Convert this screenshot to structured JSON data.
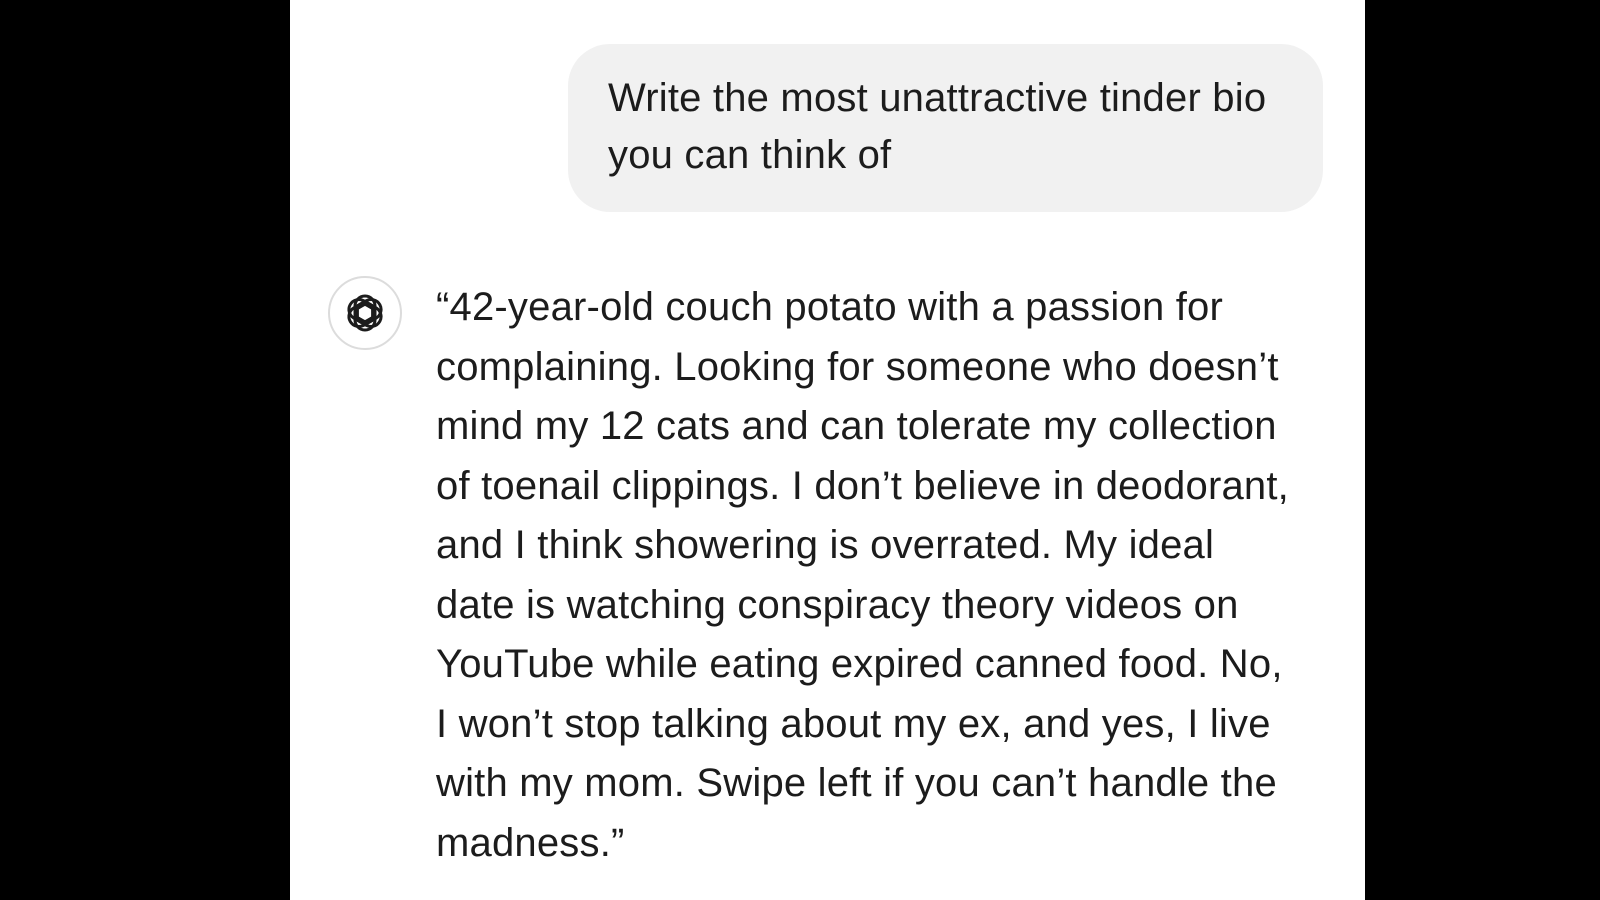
{
  "conversation": {
    "user_message": "Write the most unattractive tinder bio you can think of",
    "assistant": {
      "avatar_icon": "openai-logo-icon",
      "message": "“42-year-old couch potato with a passion for complaining. Looking for someone who doesn’t mind my 12 cats and can tolerate my collection of toenail clippings. I don’t believe in deodorant, and I think showering is overrated. My ideal date is watching conspiracy theory videos on YouTube while eating expired canned food. No, I won’t stop talking about my ex, and yes, I live with my mom. Swipe left if you can’t handle the madness.”"
    }
  },
  "colors": {
    "background": "#000000",
    "panel": "#ffffff",
    "user_bubble": "#f1f1f1",
    "text": "#1c1c1c"
  }
}
